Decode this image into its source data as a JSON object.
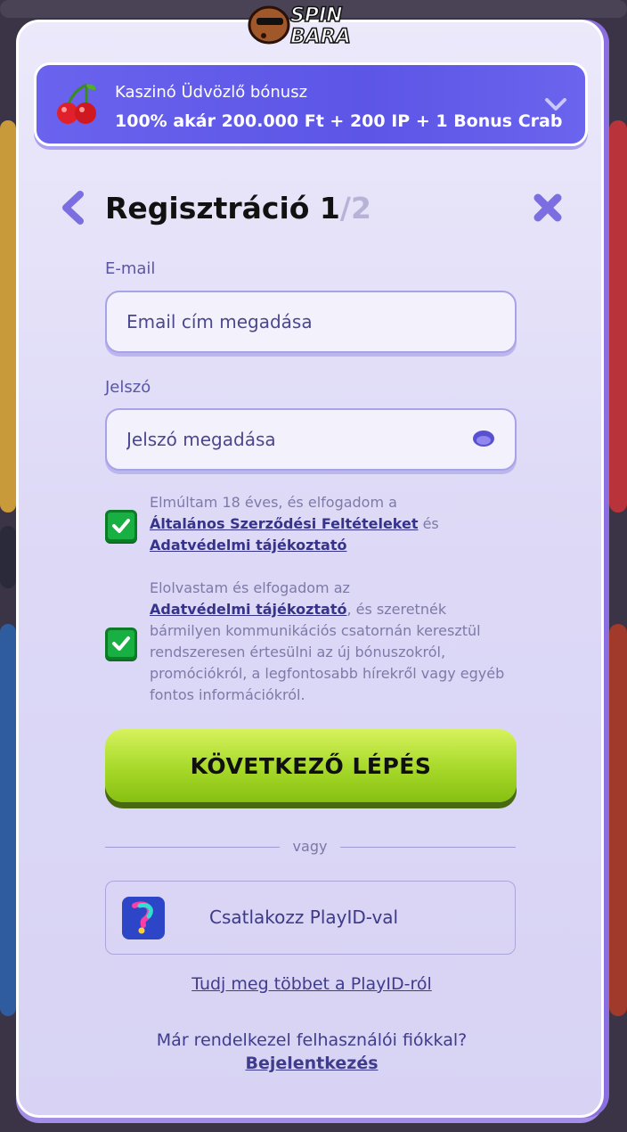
{
  "logo": {
    "text_top": "SPIN",
    "text_bottom": "BARA"
  },
  "bonus": {
    "title": "Kaszinó Üdvözlő bónusz",
    "offer": "100% akár 200.000 Ft + 200 IP + 1 Bonus Crab"
  },
  "header": {
    "title": "Regisztráció 1",
    "step_total": "/2"
  },
  "form": {
    "email_label": "E-mail",
    "email_placeholder": "Email cím megadása",
    "password_label": "Jelszó",
    "password_placeholder": "Jelszó megadása"
  },
  "consent1": {
    "text_a": "Elmúltam 18 éves, és elfogadom a ",
    "link_terms": "Általános Szerződési Feltételeket",
    "text_b": " és ",
    "link_privacy": "Adatvédelmi tájékoztató",
    "checked": true
  },
  "consent2": {
    "text_a": "Elolvastam és elfogadom az ",
    "link_privacy": "Adatvédelmi tájékoztató",
    "text_b": ", és szeretnék bármilyen kommunikációs csatornán keresztül rendszeresen értesülni az új bónuszokról, promóciókról, a legfontosabb hírekről vagy egyéb fontos információkról.",
    "checked": true
  },
  "cta": {
    "label": "KÖVETKEZŐ LÉPÉS"
  },
  "divider": {
    "label": "vagy"
  },
  "playid": {
    "label": "Csatlakozz PlayID-val",
    "learn_more": "Tudj meg többet a PlayID-ról"
  },
  "footer": {
    "have_account": "Már rendelkezel felhasználói fiókkal?",
    "login": "Bejelentkezés"
  },
  "colors": {
    "accent": "#5c55e6",
    "cta": "#a6d829",
    "check": "#18b043"
  }
}
